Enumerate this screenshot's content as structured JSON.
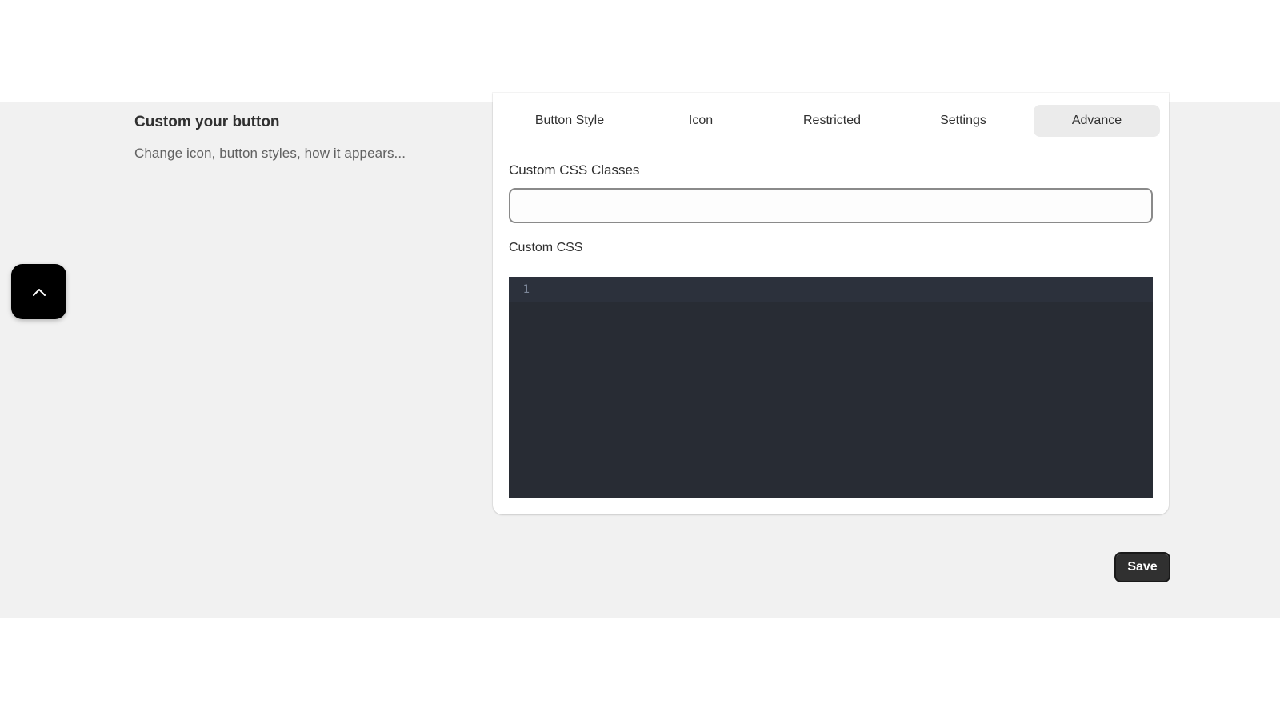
{
  "section": {
    "title": "Custom your button",
    "description": "Change icon, button styles, how it appears..."
  },
  "scroll_top": {
    "icon": "chevron-up-icon"
  },
  "tabs": [
    {
      "label": "Button Style",
      "active": false
    },
    {
      "label": "Icon",
      "active": false
    },
    {
      "label": "Restricted",
      "active": false
    },
    {
      "label": "Settings",
      "active": false
    },
    {
      "label": "Advance",
      "active": true
    }
  ],
  "advance": {
    "css_classes_label": "Custom CSS Classes",
    "css_classes_value": "",
    "custom_css_label": "Custom CSS",
    "editor_lines": [
      "1"
    ]
  },
  "actions": {
    "save_label": "Save"
  },
  "colors": {
    "band_background": "#f1f1f1",
    "editor_background": "#282c34",
    "save_button": "#303030"
  }
}
